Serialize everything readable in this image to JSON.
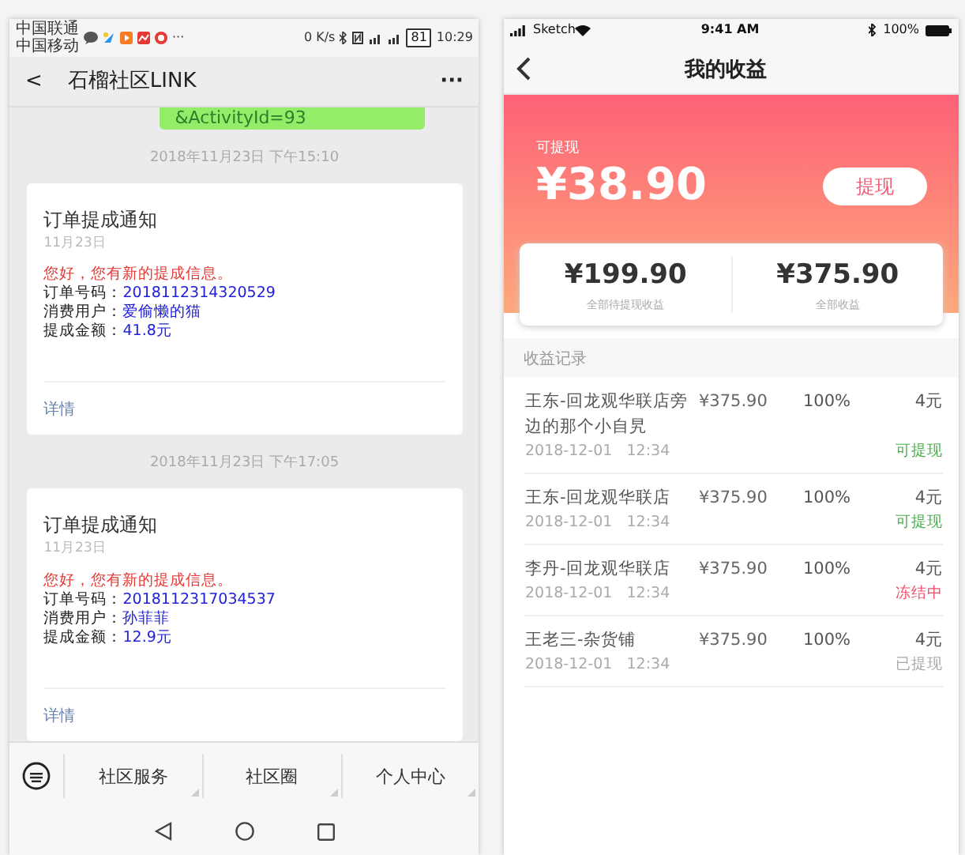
{
  "left_phone": {
    "status_bar": {
      "carriers": [
        "中国联通",
        "中国移动"
      ],
      "more": "···",
      "speed": "0 K/s",
      "battery": "81",
      "time": "10:29"
    },
    "header": {
      "back": "<",
      "title": "石榴社区LINK",
      "more": "···"
    },
    "bubble": "&ActivityId=93",
    "messages": [
      {
        "time": "2018年11月23日 下午15:10",
        "title": "订单提成通知",
        "date": "11月23日",
        "greeting": "您好，您有新的提成信息。",
        "fields": [
          {
            "label": "订单号码：",
            "value": "2018112314320529"
          },
          {
            "label": "消费用户：",
            "value": "爱偷懒的猫"
          },
          {
            "label": "提成金额：",
            "value": "41.8元"
          }
        ],
        "link": "详情"
      },
      {
        "time": "2018年11月23日 下午17:05",
        "title": "订单提成通知",
        "date": "11月23日",
        "greeting": "您好，您有新的提成信息。",
        "fields": [
          {
            "label": "订单号码：",
            "value": "2018112317034537"
          },
          {
            "label": "消费用户：",
            "value": "孙菲菲"
          },
          {
            "label": "提成金额：",
            "value": "12.9元"
          }
        ],
        "link": "详情"
      }
    ],
    "menu": [
      "社区服务",
      "社区圈",
      "个人中心"
    ]
  },
  "right_phone": {
    "status_bar": {
      "carrier": "Sketch",
      "time": "9:41 AM",
      "battery": "100%"
    },
    "header": {
      "title": "我的收益"
    },
    "withdrawable": {
      "label": "可提现",
      "amount": "¥38.90",
      "button": "提现"
    },
    "summary": [
      {
        "amount": "¥199.90",
        "label": "全部待提现收益"
      },
      {
        "amount": "¥375.90",
        "label": "全部收益"
      }
    ],
    "records_title": "收益记录",
    "records": [
      {
        "name": "王东-回龙观华联店旁边的那个小自旯",
        "amount": "¥375.90",
        "percent": "100%",
        "reward": "4元",
        "time": "2018-12-01   12:34",
        "status": "可提现",
        "color": "#4caf50"
      },
      {
        "name": "王东-回龙观华联店",
        "amount": "¥375.90",
        "percent": "100%",
        "reward": "4元",
        "time": "2018-12-01   12:34",
        "status": "可提现",
        "color": "#4caf50"
      },
      {
        "name": "李丹-回龙观华联店",
        "amount": "¥375.90",
        "percent": "100%",
        "reward": "4元",
        "time": "2018-12-01   12:34",
        "status": "冻结中",
        "color": "#f0506e"
      },
      {
        "name": "王老三-杂货铺",
        "amount": "¥375.90",
        "percent": "100%",
        "reward": "4元",
        "time": "2018-12-01   12:34",
        "status": "已提现",
        "color": "#aaaaaa"
      }
    ]
  }
}
